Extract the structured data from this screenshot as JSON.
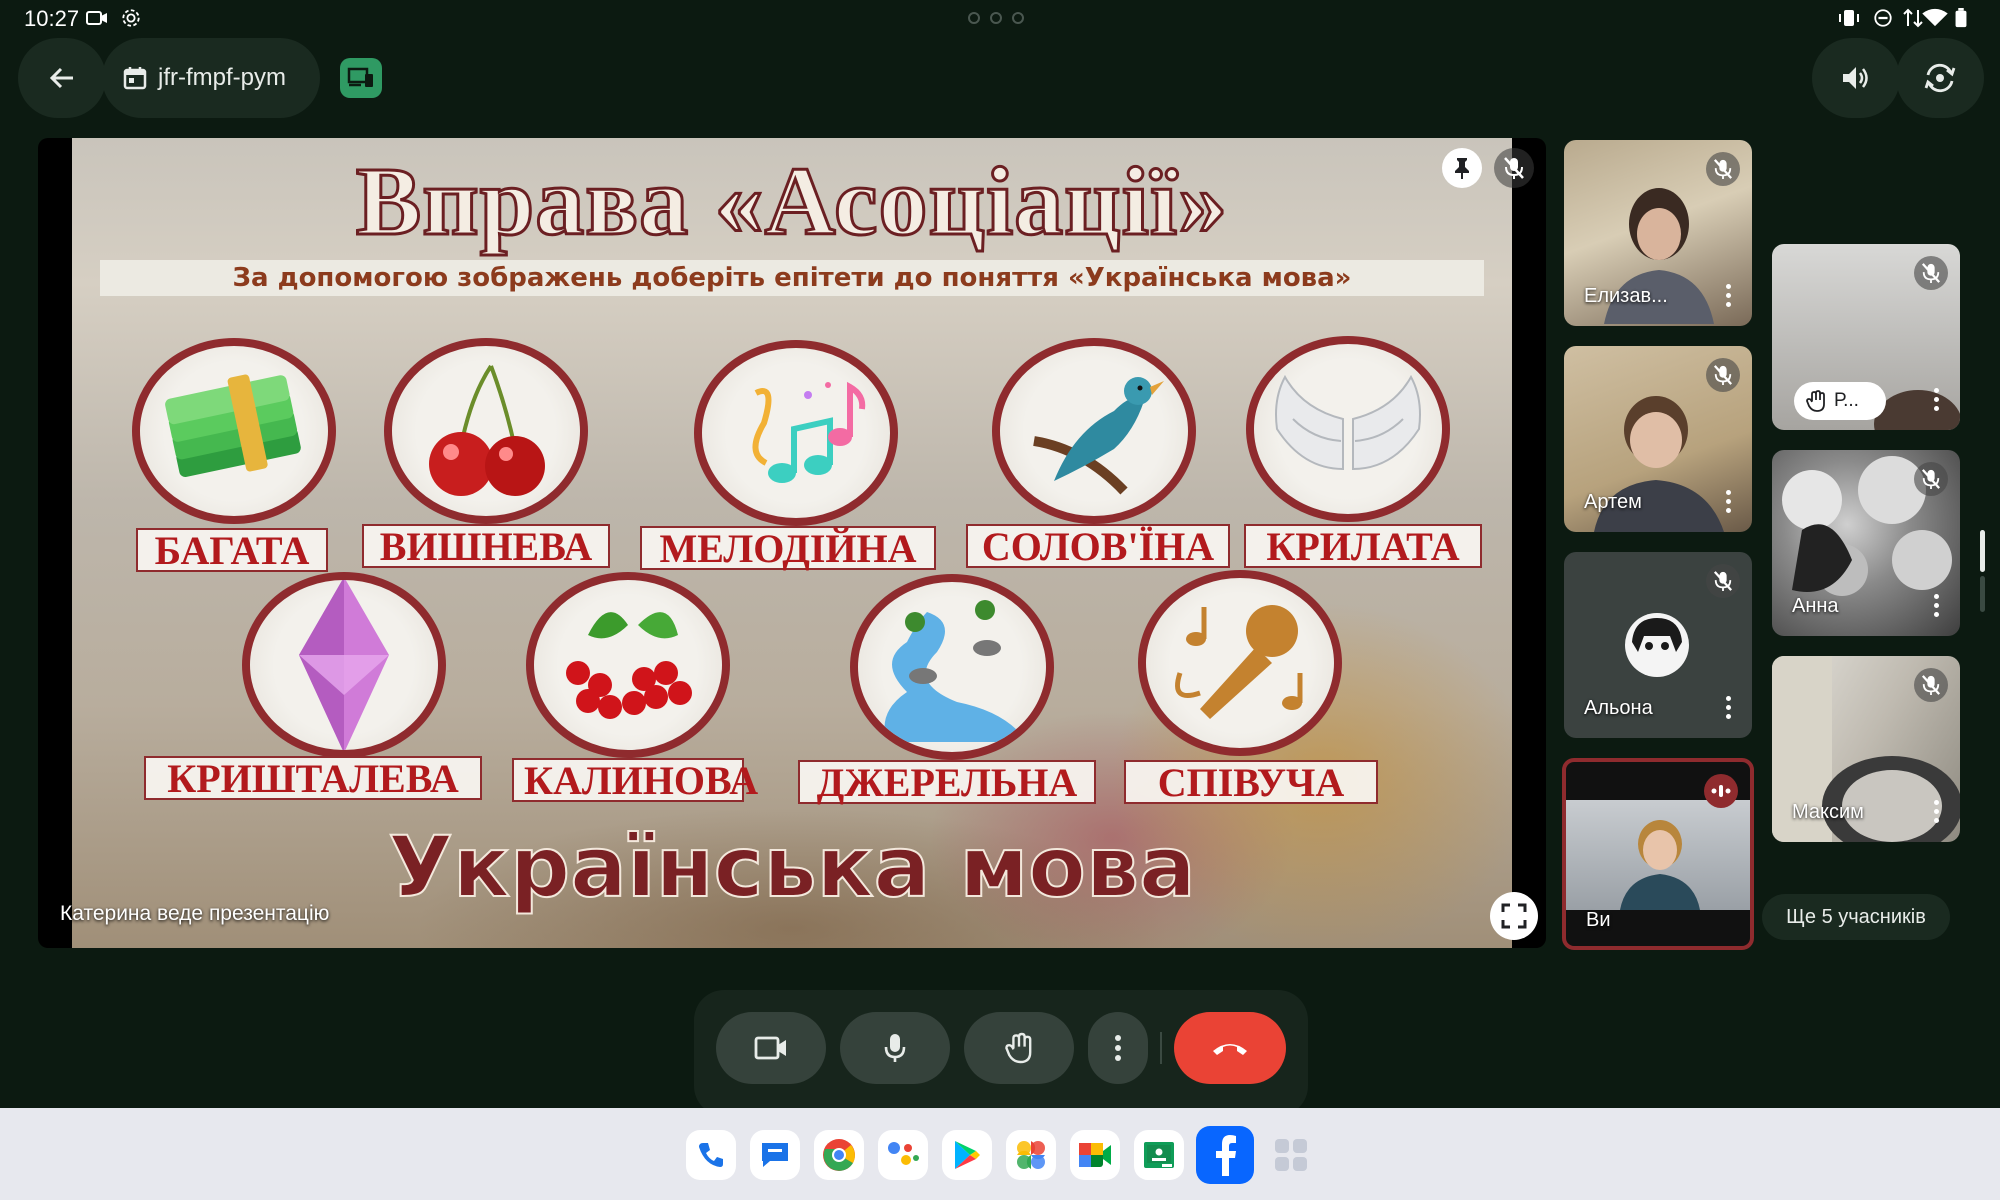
{
  "status_bar": {
    "time": "10:27"
  },
  "top_bar": {
    "meeting_code": "jfr-fmpf-pym"
  },
  "slide": {
    "title": "Вправа «Асоціації»",
    "subtitle": "За допомогою зображень доберіть епітети до поняття «Українська мова»",
    "row1": [
      "БАГАТА",
      "ВИШНЕВА",
      "МЕЛОДІЙНА",
      "СОЛОВ'ЇНА",
      "КРИЛАТА"
    ],
    "row2": [
      "КРИШТАЛЕВА",
      "КАЛИНОВА",
      "ДЖЕРЕЛЬНА",
      "СПІВУЧА"
    ],
    "footer": "Українська мова",
    "presenter_label": "Катерина веде презентацію"
  },
  "participants": [
    {
      "name": "Елизав..."
    },
    {
      "name": "Артем"
    },
    {
      "name": "Альона"
    },
    {
      "name": "Ви"
    },
    {
      "name": "Р..."
    },
    {
      "name": "Анна"
    },
    {
      "name": "Максим"
    }
  ],
  "more_participants": "Ще 5 учасників",
  "colors": {
    "background": "#0c1a11",
    "accent_green": "#2f9a63",
    "hangup_red": "#ea4335",
    "slide_red": "#b21a1d",
    "active_speaker_border": "#8f2b2e"
  }
}
